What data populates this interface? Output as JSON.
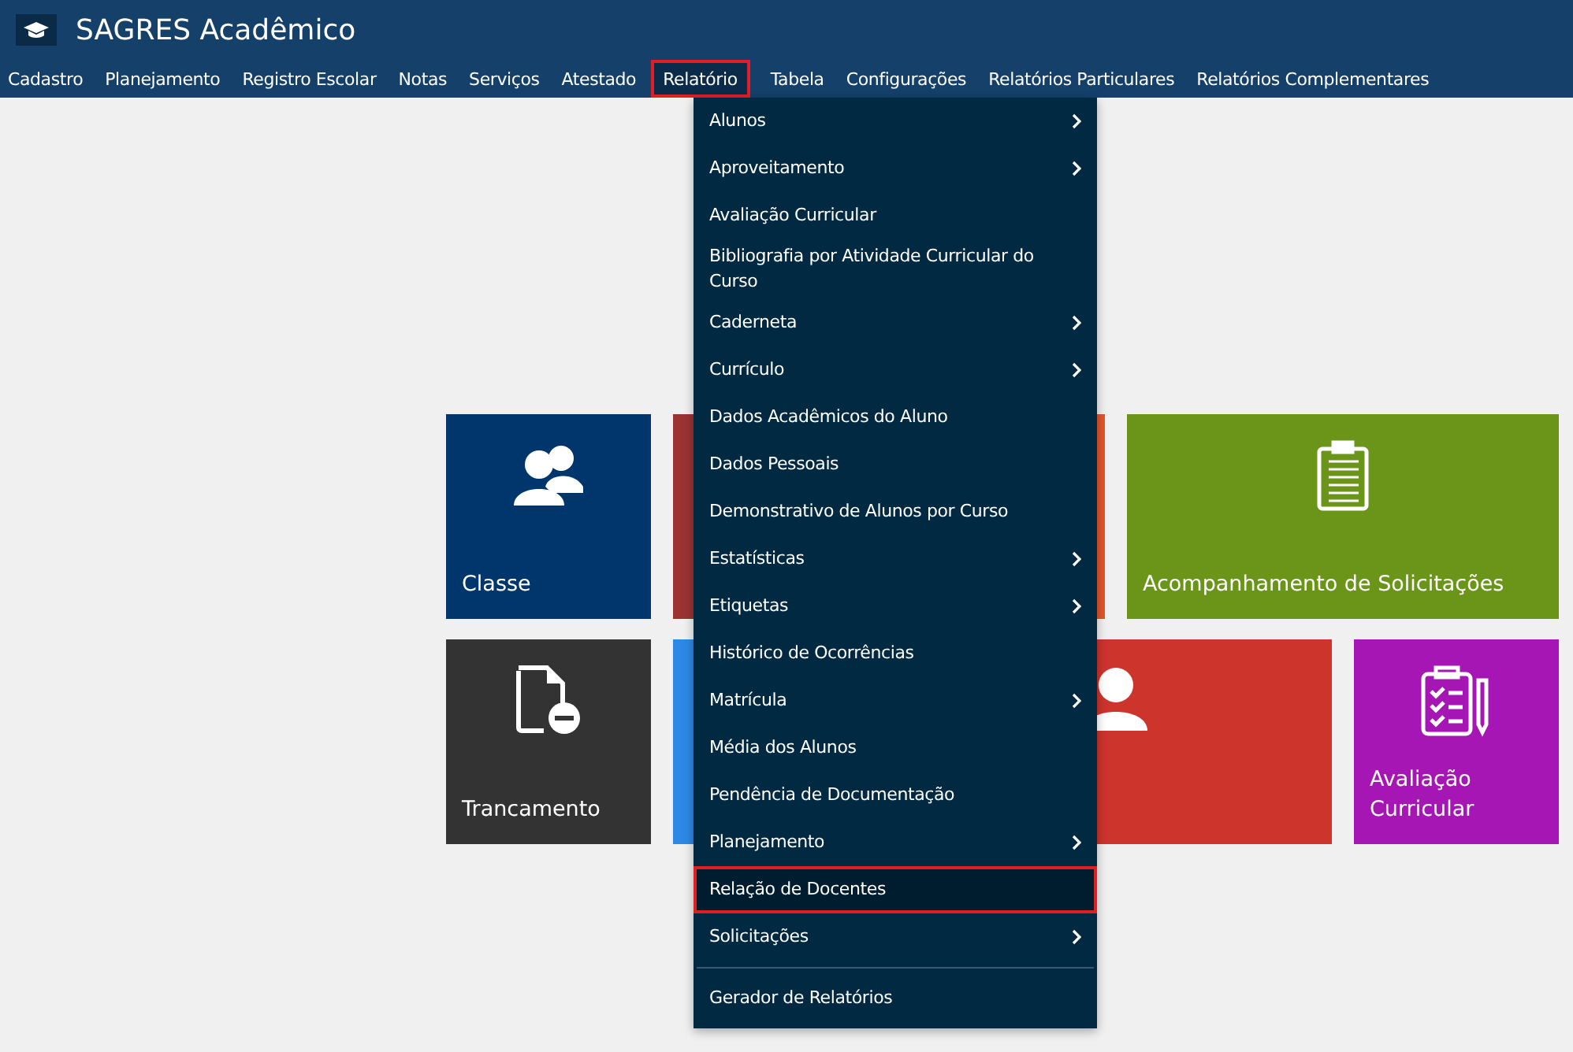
{
  "app": {
    "title": "SAGRES Acadêmico"
  },
  "nav": [
    {
      "label": "Cadastro",
      "selected": false
    },
    {
      "label": "Planejamento",
      "selected": false
    },
    {
      "label": "Registro Escolar",
      "selected": false
    },
    {
      "label": "Notas",
      "selected": false
    },
    {
      "label": "Serviços",
      "selected": false
    },
    {
      "label": "Atestado",
      "selected": false
    },
    {
      "label": "Relatório",
      "selected": true
    },
    {
      "label": "Tabela",
      "selected": false
    },
    {
      "label": "Configurações",
      "selected": false
    },
    {
      "label": "Relatórios Particulares",
      "selected": false
    },
    {
      "label": "Relatórios Complementares",
      "selected": false
    }
  ],
  "menu": [
    {
      "label": "Alunos",
      "submenu": true,
      "selected": false
    },
    {
      "label": "Aproveitamento",
      "submenu": true,
      "selected": false
    },
    {
      "label": "Avaliação Curricular",
      "submenu": false,
      "selected": false
    },
    {
      "label": "Bibliografia por Atividade Curricular do Curso",
      "submenu": false,
      "selected": false
    },
    {
      "label": "Caderneta",
      "submenu": true,
      "selected": false
    },
    {
      "label": "Currículo",
      "submenu": true,
      "selected": false
    },
    {
      "label": "Dados Acadêmicos do Aluno",
      "submenu": false,
      "selected": false
    },
    {
      "label": "Dados Pessoais",
      "submenu": false,
      "selected": false
    },
    {
      "label": "Demonstrativo de Alunos por Curso",
      "submenu": false,
      "selected": false
    },
    {
      "label": "Estatísticas",
      "submenu": true,
      "selected": false
    },
    {
      "label": "Etiquetas",
      "submenu": true,
      "selected": false
    },
    {
      "label": "Histórico de Ocorrências",
      "submenu": false,
      "selected": false
    },
    {
      "label": "Matrícula",
      "submenu": true,
      "selected": false
    },
    {
      "label": "Média dos Alunos",
      "submenu": false,
      "selected": false
    },
    {
      "label": "Pendência de Documentação",
      "submenu": false,
      "selected": false
    },
    {
      "label": "Planejamento",
      "submenu": true,
      "selected": false
    },
    {
      "label": "Relação de Docentes",
      "submenu": false,
      "selected": true
    },
    {
      "label": "Solicitações",
      "submenu": true,
      "selected": false
    }
  ],
  "menu_footer": {
    "label": "Gerador de Relatórios"
  },
  "tiles": [
    {
      "label": "Classe",
      "color": "#00366b",
      "wide": false
    },
    {
      "color": "#9b3333",
      "wide": false
    },
    {
      "color": "#e0582a",
      "wide": false
    },
    {
      "label": "Acompanhamento de Solicitações",
      "color": "#6a9519",
      "wide": true
    },
    {
      "label": "Trancamento",
      "color": "#333333",
      "wide": false
    },
    {
      "color": "#2d89e5",
      "wide": false
    },
    {
      "color": "#cc342c",
      "wide": true
    },
    {
      "label": "Avaliação Curricular",
      "color": "#a516b5",
      "wide": false
    }
  ]
}
